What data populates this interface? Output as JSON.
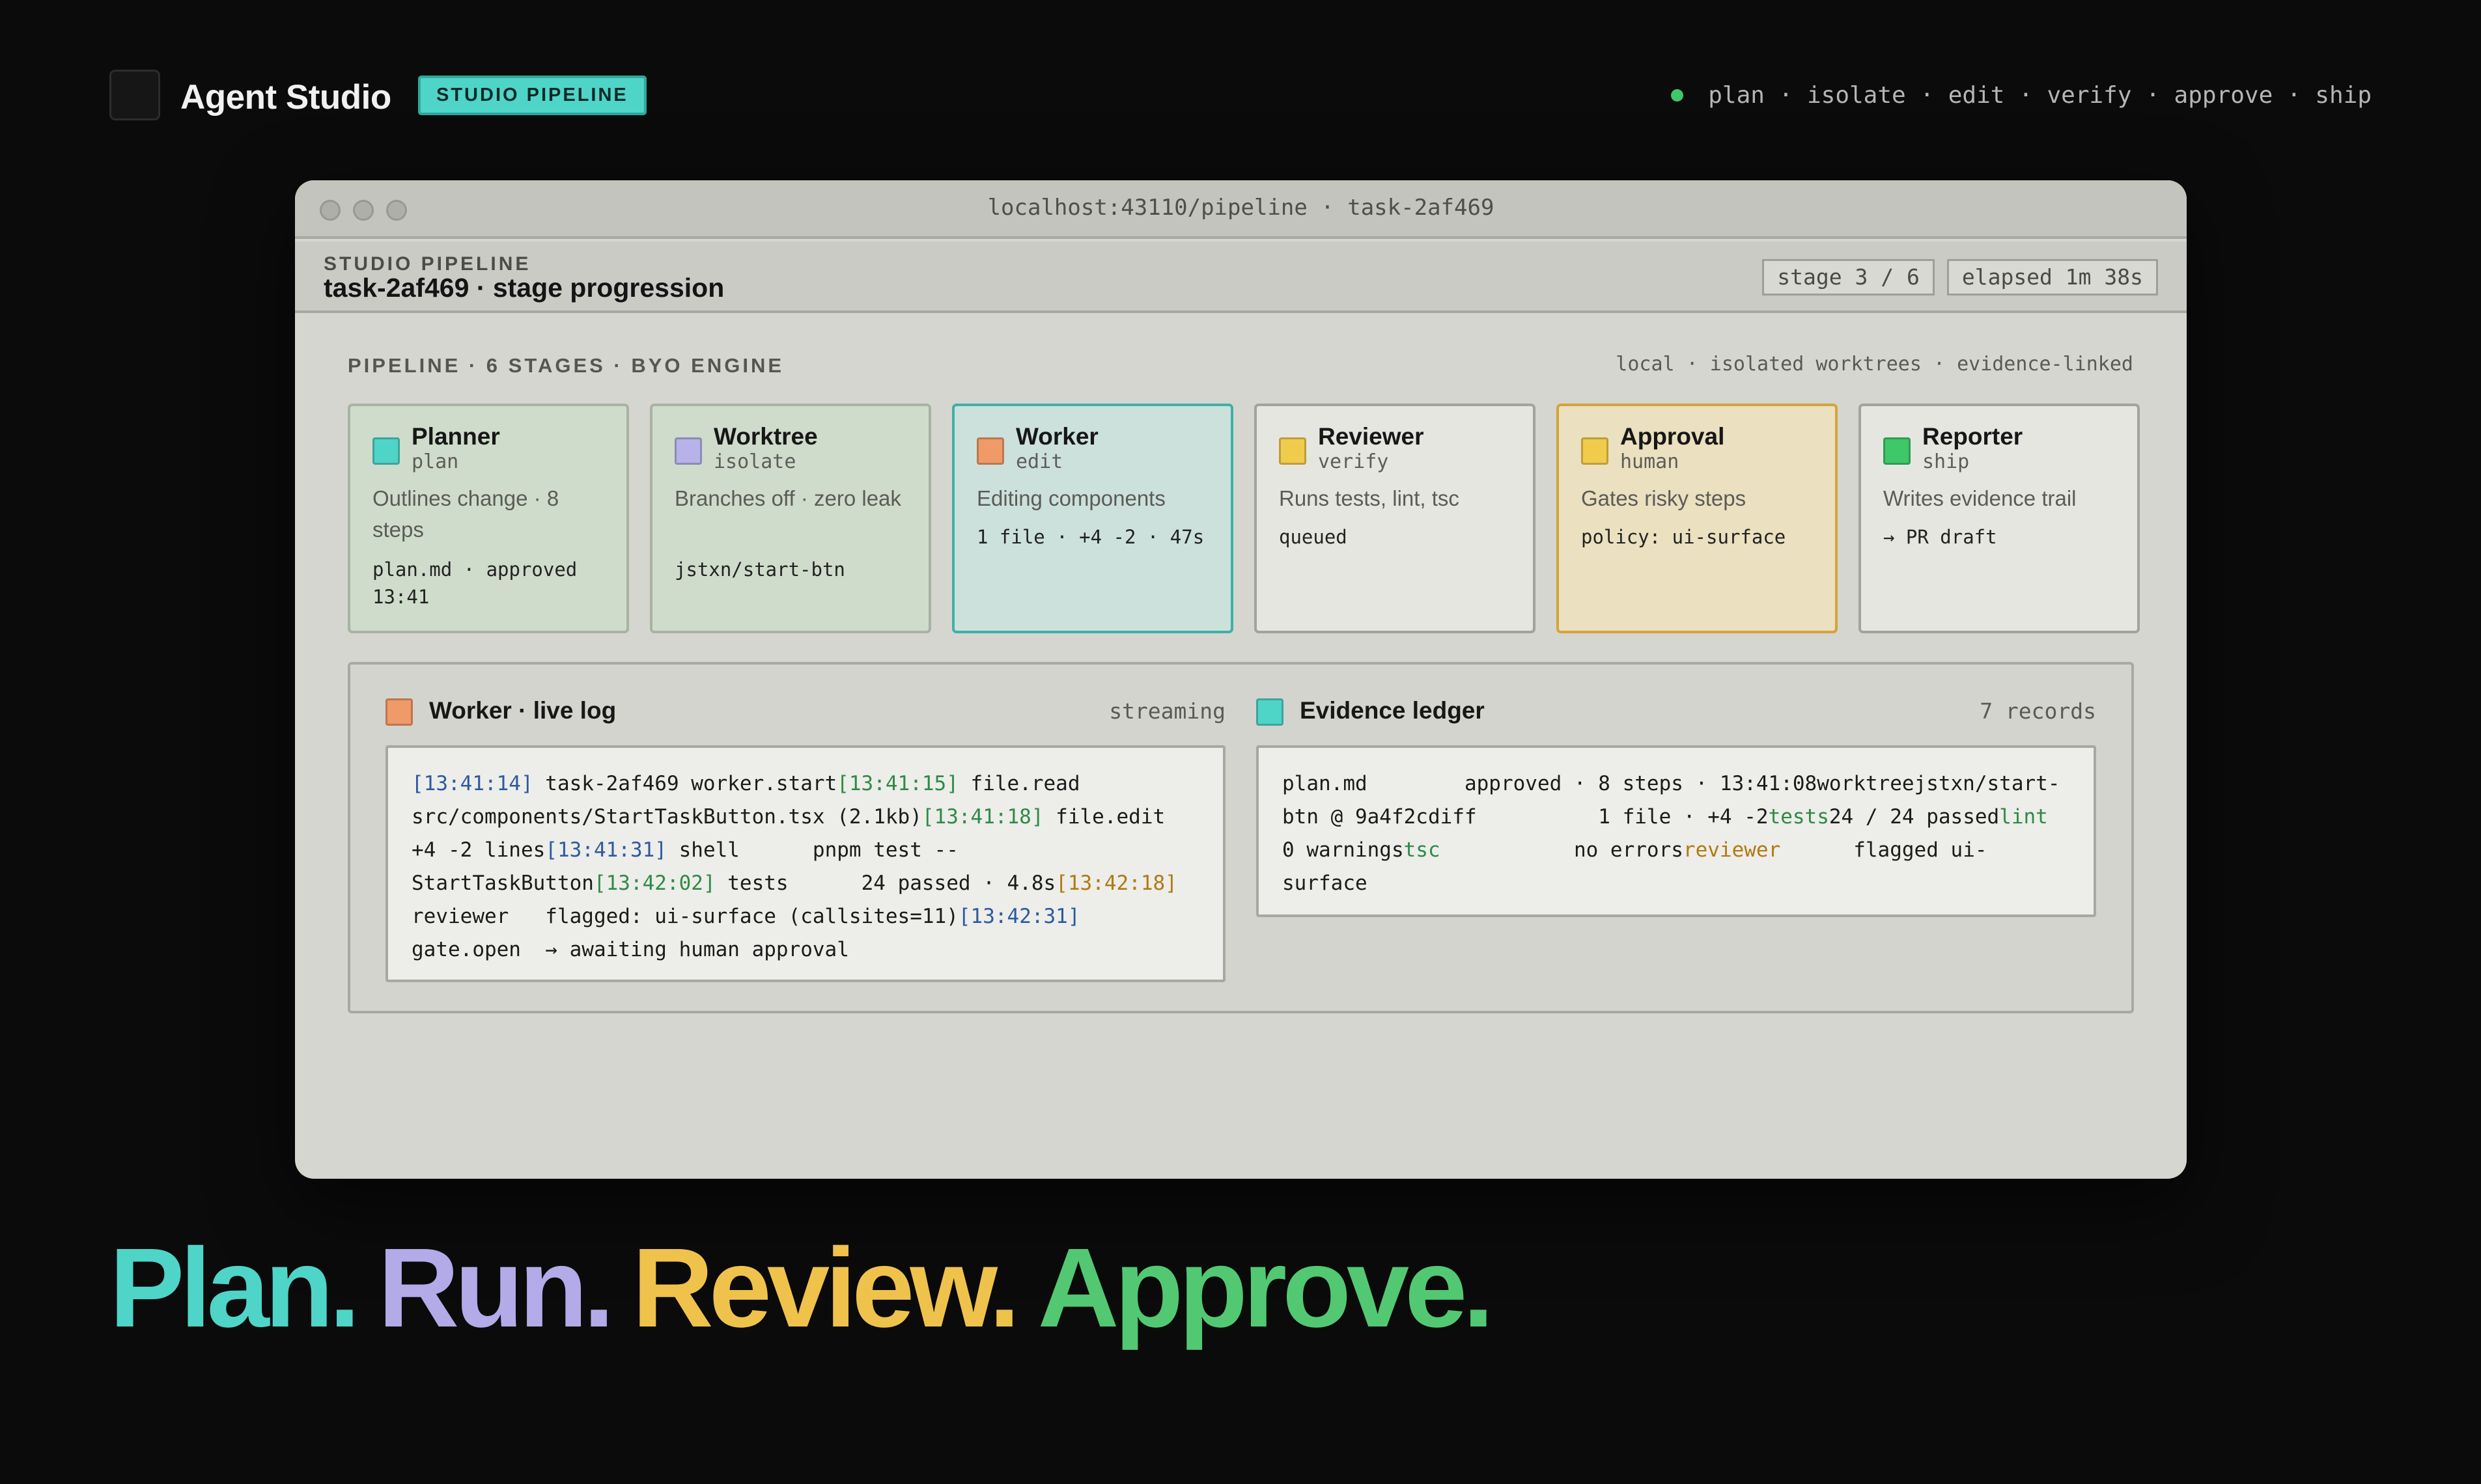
{
  "brand": {
    "name": "Agent Studio",
    "badge": "STUDIO PIPELINE"
  },
  "top_steps": [
    "plan",
    "isolate",
    "edit",
    "verify",
    "approve",
    "ship"
  ],
  "window": {
    "url": "localhost:43110/pipeline · task-2af469",
    "eyebrow": "STUDIO PIPELINE",
    "title": "task-2af469 · stage progression",
    "stage_chip": "stage 3 / 6",
    "elapsed_chip": "elapsed 1m 38s"
  },
  "pipeline": {
    "label": "PIPELINE · 6 STAGES · BYO ENGINE",
    "meta": "local · isolated worktrees · evidence-linked",
    "stages": [
      {
        "name": "Planner",
        "verb": "plan",
        "desc": "Outlines change · 8 steps",
        "meta": "plan.md · approved 13:41",
        "color": "#4fd4c8"
      },
      {
        "name": "Worktree",
        "verb": "isolate",
        "desc": "Branches off · zero leak",
        "meta": "jstxn/start-btn",
        "color": "#b7b2e8"
      },
      {
        "name": "Worker",
        "verb": "edit",
        "desc": "Editing components",
        "meta": "1 file · +4 -2 · 47s",
        "color": "#ef9a68"
      },
      {
        "name": "Reviewer",
        "verb": "verify",
        "desc": "Runs tests, lint, tsc",
        "meta": "queued",
        "color": "#f1cb4c"
      },
      {
        "name": "Approval",
        "verb": "human",
        "desc": "Gates risky steps",
        "meta": "policy: ui-surface",
        "color": "#f1cb4c"
      },
      {
        "name": "Reporter",
        "verb": "ship",
        "desc": "Writes evidence trail",
        "meta": "→ PR draft",
        "color": "#3ec869"
      }
    ]
  },
  "log": {
    "title": "Worker · live log",
    "status": "streaming",
    "color": "#ef9a68",
    "lines": [
      {
        "time": "[13:41:14]",
        "text": " task-2af469 worker.start"
      },
      {
        "time": "[13:41:15]",
        "text": " file.read src/components/StartTaskButton.tsx (2.1kb)"
      },
      {
        "time": "[13:41:18]",
        "text": " file.edit +4 -2 lines"
      },
      {
        "time": "[13:41:31]",
        "text": " shell      pnpm test -- StartTaskButton"
      },
      {
        "time": "[13:42:02]",
        "text": " tests      24 passed · 4.8s"
      },
      {
        "time": "[13:42:18]",
        "text": " reviewer   flagged: ui-surface (callsites=11)"
      },
      {
        "time": "[13:42:31]",
        "text": " gate.open  → awaiting human approval"
      }
    ]
  },
  "ledger": {
    "title": "Evidence ledger",
    "count": "7 records",
    "color": "#4fd4c8",
    "rows": [
      {
        "key": "plan.md",
        "value": "        approved · 8 steps · 13:41:08"
      },
      {
        "key": "worktree",
        "value": "jstxn/start-btn @ 9a4f2c"
      },
      {
        "key": "diff",
        "value": "          1 file · +4 -2"
      },
      {
        "key": "tests",
        "value": "24 / 24 passed"
      },
      {
        "key": "lint",
        "value": "          0 warnings"
      },
      {
        "key": "tsc",
        "value": "           no errors"
      },
      {
        "key": "reviewer",
        "value": "      flagged ui-surface"
      }
    ]
  },
  "tagline": [
    "Plan.",
    "Run.",
    "Review.",
    "Approve."
  ]
}
